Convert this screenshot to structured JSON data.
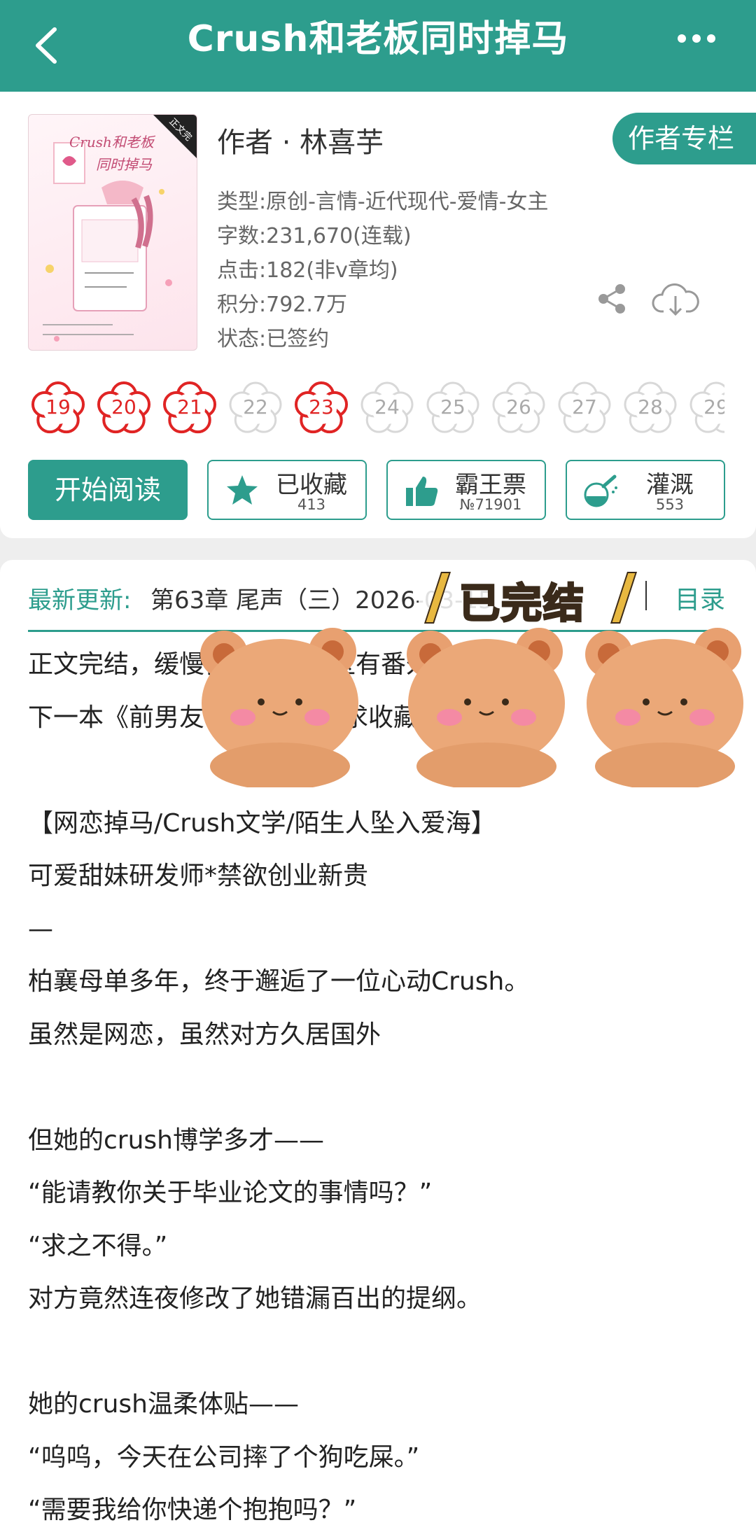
{
  "navbar": {
    "title": "Crush和老板同时掉马",
    "back_icon": "chevron-left-icon",
    "more_icon": "more-dots-icon"
  },
  "book": {
    "cover_title_line1": "Crush和老板",
    "cover_title_line2": "同时掉马",
    "cover_badge": "正文完",
    "author_line": "作者 · 林喜芋",
    "author_column_button": "作者专栏",
    "type_line": "类型:原创-言情-近代现代-爱情-女主",
    "word_count_line": "字数:231,670(连载)",
    "clicks_line": "点击:182(非v章均)",
    "score_line": "积分:792.7万",
    "status_line": "状态:已签约"
  },
  "rating_flowers": [
    {
      "label": "19",
      "active": true
    },
    {
      "label": "20",
      "active": true
    },
    {
      "label": "21",
      "active": true
    },
    {
      "label": "22",
      "active": false
    },
    {
      "label": "23",
      "active": true
    },
    {
      "label": "24",
      "active": false
    },
    {
      "label": "25",
      "active": false
    },
    {
      "label": "26",
      "active": false
    },
    {
      "label": "27",
      "active": false
    },
    {
      "label": "28",
      "active": false
    },
    {
      "label": "29",
      "active": false
    }
  ],
  "actions": {
    "read_button": "开始阅读",
    "favorite_label": "已收藏",
    "favorite_count": "413",
    "ticket_label": "霸王票",
    "ticket_count": "№71901",
    "nutrient_label": "灌溉",
    "nutrient_count": "553"
  },
  "latest": {
    "label": "最新更新:",
    "text": "第63章 尾声（三）2026-03-15",
    "catalog_link": "目录"
  },
  "sticker_text": "已完结",
  "description": [
    "正文完结，缓慢修文，评论区有番外",
    "下一本《前男友……遗产》，求收藏，",
    "",
    "【网恋掉马/Crush文学/陌生人坠入爱海】",
    "可爱甜妹研发师*禁欲创业新贵",
    "—",
    "柏襄母单多年，终于邂逅了一位心动Crush。",
    "虽然是网恋，虽然对方久居国外",
    "",
    "但她的crush博学多才——",
    "“能请教你关于毕业论文的事情吗？”",
    "“求之不得。”",
    "对方竟然连夜修改了她错漏百出的提纲。",
    "",
    "她的crush温柔体贴——",
    "“呜呜，今天在公司摔了个狗吃屎。”",
    "“需要我给你快递个抱抱吗？”"
  ],
  "colors": {
    "accent": "#2d9d8d",
    "flower_active": "#e02424",
    "flower_inactive": "#d8d8d8"
  }
}
